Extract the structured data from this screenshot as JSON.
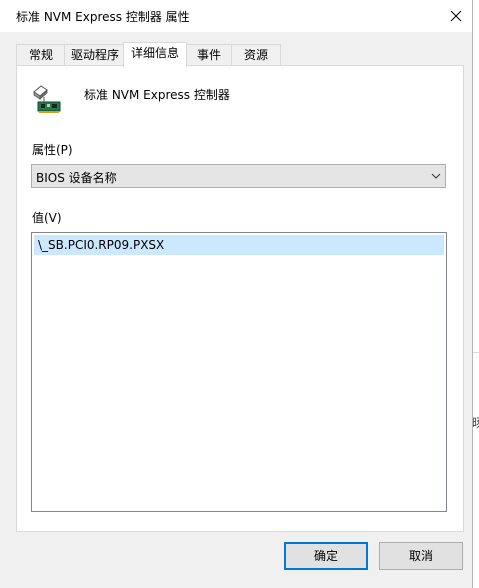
{
  "window": {
    "title": "标准 NVM Express 控制器 属性"
  },
  "tabs": [
    {
      "label": "常规"
    },
    {
      "label": "驱动程序"
    },
    {
      "label": "详细信息"
    },
    {
      "label": "事件"
    },
    {
      "label": "资源"
    }
  ],
  "active_tab": "详细信息",
  "device": {
    "icon": "storage-controller-icon",
    "name": "标准 NVM Express 控制器"
  },
  "property": {
    "label": "属性(P)",
    "selected": "BIOS 设备名称"
  },
  "value": {
    "label": "值(V)",
    "items": [
      "\\_SB.PCI0.RP09.PXSX"
    ]
  },
  "buttons": {
    "ok": "确定",
    "cancel": "取消"
  },
  "background": {
    "glyph": "旸"
  },
  "colors": {
    "selection": "#cce8ff",
    "default_button_border": "#0078d7"
  }
}
